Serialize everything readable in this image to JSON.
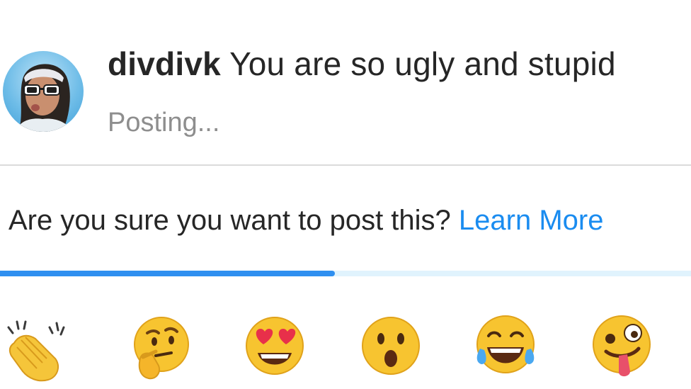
{
  "comment": {
    "username": "divdivk",
    "text": "You are so ugly and stupid",
    "status": "Posting..."
  },
  "warning": {
    "text": "Are you sure you want to post this?",
    "link": "Learn More"
  },
  "progress": {
    "value": 0.485
  },
  "reactions": [
    {
      "name": "clapping-hands",
      "glyph": "👏"
    },
    {
      "name": "thinking-face",
      "glyph": "🤔"
    },
    {
      "name": "heart-eyes-face",
      "glyph": "😍"
    },
    {
      "name": "surprised-face",
      "glyph": "😮"
    },
    {
      "name": "tears-of-joy-face",
      "glyph": "😂"
    },
    {
      "name": "zany-face",
      "glyph": "🤪"
    }
  ],
  "colors": {
    "link": "#1a8cf0",
    "progress_fill": "#2f8ff0",
    "progress_track": "#e0f3fd",
    "text": "#262626",
    "muted": "#8e8e8e",
    "divider": "#dbdbdb"
  }
}
